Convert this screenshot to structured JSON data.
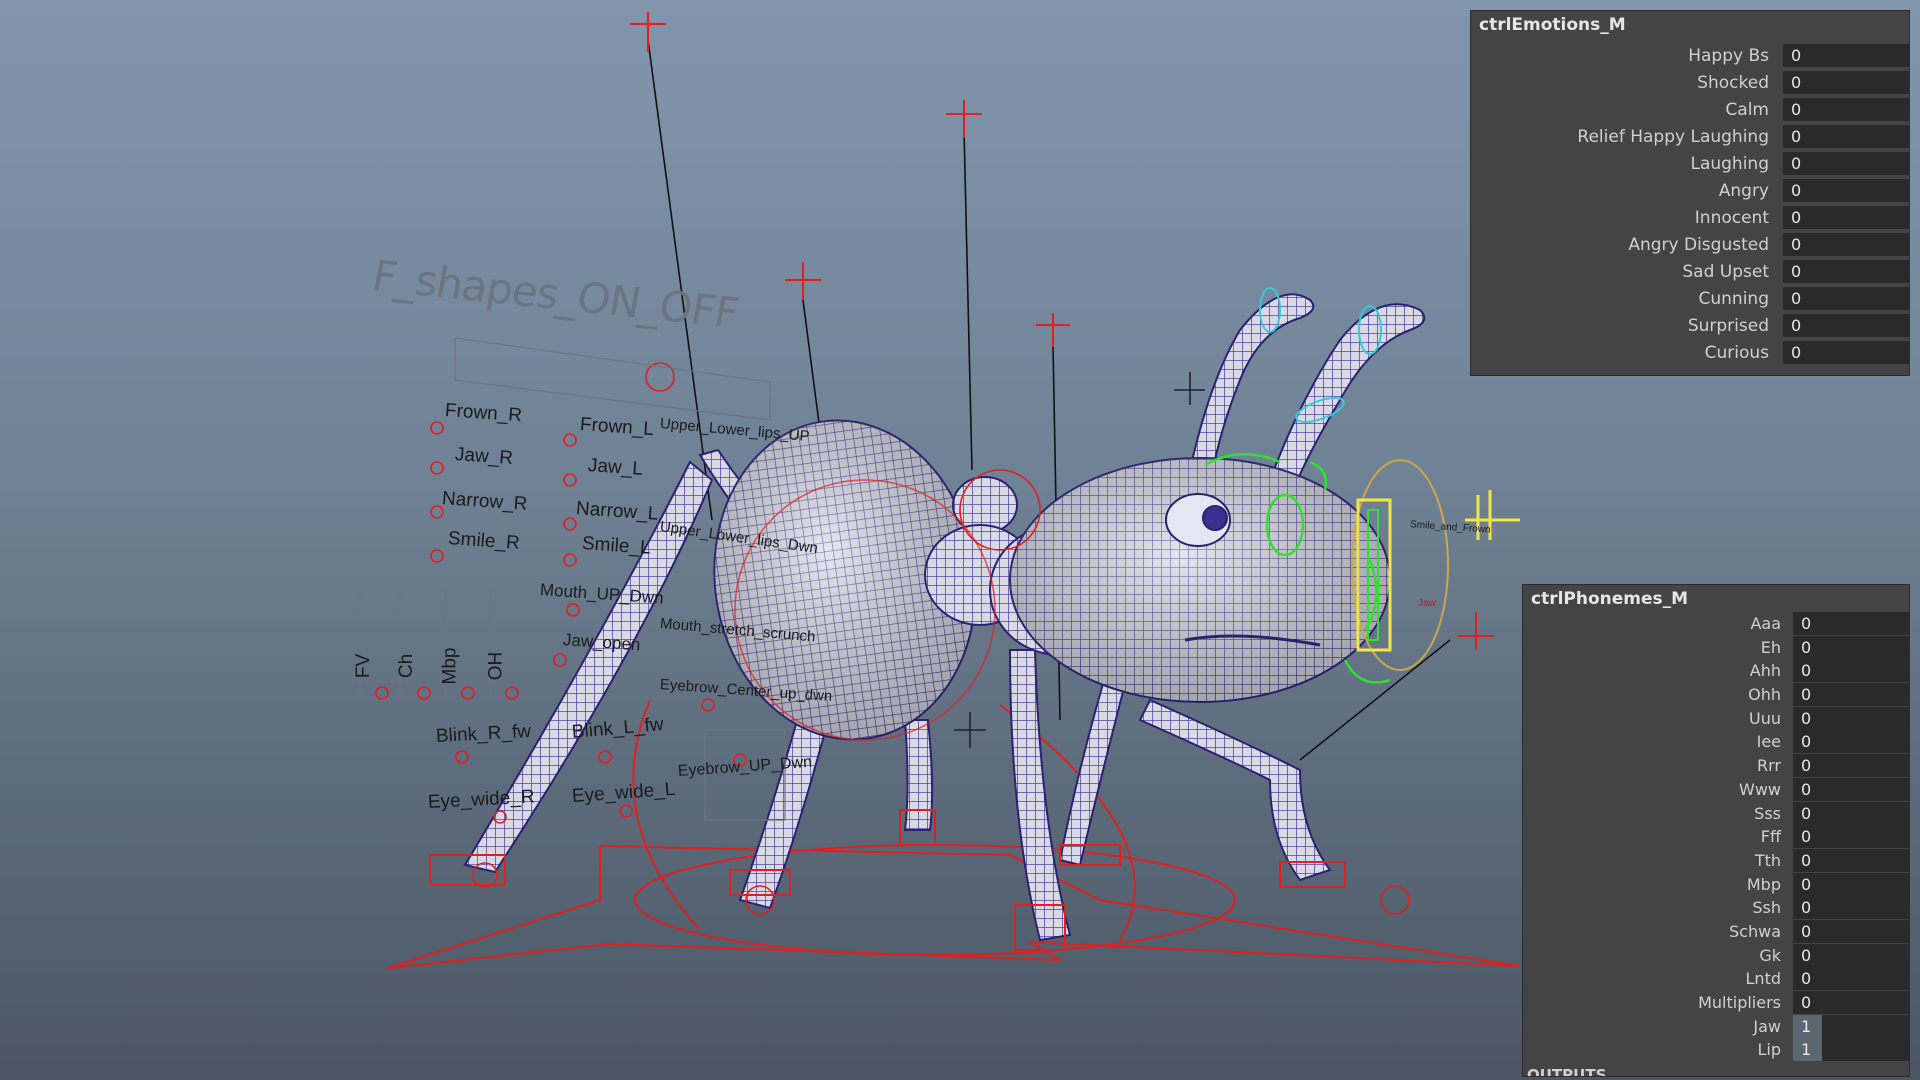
{
  "viewport": {
    "title_3d": "F_shapes_ON_OFF",
    "face_controls": [
      {
        "text": "Frown_R"
      },
      {
        "text": "Jaw_R"
      },
      {
        "text": "Narrow_R"
      },
      {
        "text": "Smile_R"
      },
      {
        "text": "Frown_L"
      },
      {
        "text": "Jaw_L"
      },
      {
        "text": "Narrow_L"
      },
      {
        "text": "Smile_L"
      },
      {
        "text": "Upper_Lower_lips_UP"
      },
      {
        "text": "Upper_Lower_lips_Dwn"
      },
      {
        "text": "Mouth_UP_Dwn"
      },
      {
        "text": "Mouth_stretch_scrunch"
      },
      {
        "text": "Jaw_open"
      },
      {
        "text": "Eyebrow_Center_up_dwn"
      },
      {
        "text": "Blink_R_fw"
      },
      {
        "text": "Blink_L_fw"
      },
      {
        "text": "Eye_wide_R"
      },
      {
        "text": "Eye_wide_L"
      },
      {
        "text": "Eyebrow_UP_Dwn"
      },
      {
        "text": "FV"
      },
      {
        "text": "Ch"
      },
      {
        "text": "Mbp"
      },
      {
        "text": "OH"
      }
    ],
    "mini_labels": [
      "Smile_and_Frown",
      "Jaw"
    ]
  },
  "emotions_panel": {
    "title": "ctrlEmotions_M",
    "attributes": [
      {
        "label": "Happy Bs",
        "value": "0"
      },
      {
        "label": "Shocked",
        "value": "0"
      },
      {
        "label": "Calm",
        "value": "0"
      },
      {
        "label": "Relief Happy Laughing",
        "value": "0"
      },
      {
        "label": "Laughing",
        "value": "0"
      },
      {
        "label": "Angry",
        "value": "0"
      },
      {
        "label": "Innocent",
        "value": "0"
      },
      {
        "label": "Angry Disgusted",
        "value": "0"
      },
      {
        "label": "Sad Upset",
        "value": "0"
      },
      {
        "label": "Cunning",
        "value": "0"
      },
      {
        "label": "Surprised",
        "value": "0"
      },
      {
        "label": "Curious",
        "value": "0"
      }
    ]
  },
  "phonemes_panel": {
    "title": "ctrlPhonemes_M",
    "attributes": [
      {
        "label": "Aaa",
        "value": "0"
      },
      {
        "label": "Eh",
        "value": "0"
      },
      {
        "label": "Ahh",
        "value": "0"
      },
      {
        "label": "Ohh",
        "value": "0"
      },
      {
        "label": "Uuu",
        "value": "0"
      },
      {
        "label": "Iee",
        "value": "0"
      },
      {
        "label": "Rrr",
        "value": "0"
      },
      {
        "label": "Www",
        "value": "0"
      },
      {
        "label": "Sss",
        "value": "0"
      },
      {
        "label": "Fff",
        "value": "0"
      },
      {
        "label": "Tth",
        "value": "0"
      },
      {
        "label": "Mbp",
        "value": "0"
      },
      {
        "label": "Ssh",
        "value": "0"
      },
      {
        "label": "Schwa",
        "value": "0"
      },
      {
        "label": "Gk",
        "value": "0"
      },
      {
        "label": "Lntd",
        "value": "0"
      },
      {
        "label": "Multipliers",
        "value": "0"
      },
      {
        "label": "Jaw",
        "value": "1",
        "fill": 0.25
      },
      {
        "label": "Lip",
        "value": "1",
        "fill": 0.25
      }
    ],
    "footer": "OUTPUTS"
  },
  "colors": {
    "mesh": "#3b2f8f",
    "controls_red": "#e02020",
    "controls_green": "#30e030",
    "controls_yellow": "#f2e640",
    "panel_bg": "#444444",
    "field_bg": "#2a2a2a"
  }
}
